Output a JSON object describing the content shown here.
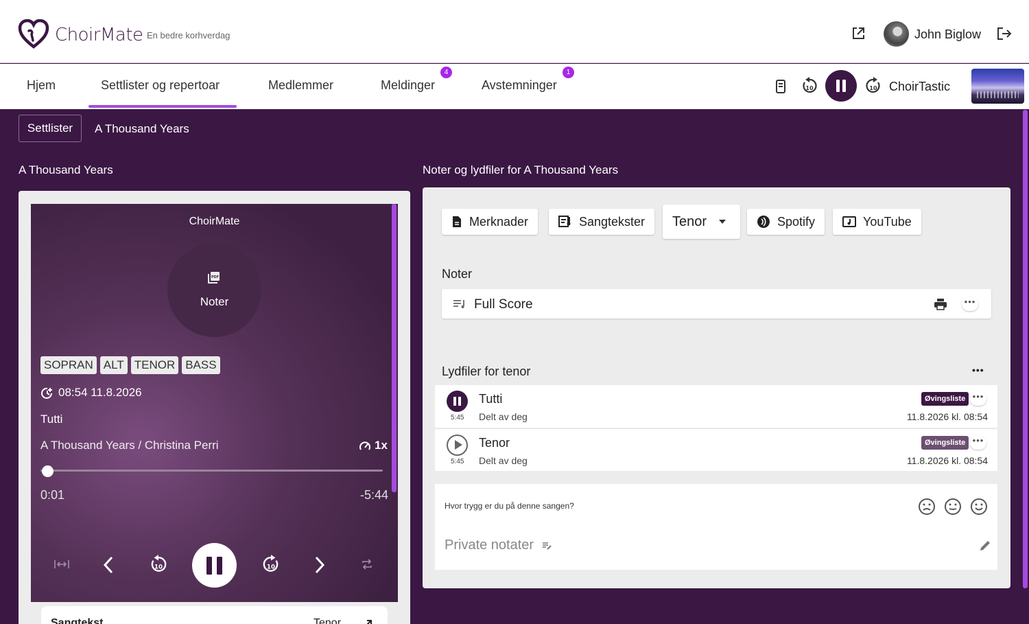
{
  "header": {
    "brand": "ChoirMate",
    "tagline": "En bedre korhverdag",
    "user_name": "John Biglow"
  },
  "nav": {
    "items": [
      {
        "label": "Hjem"
      },
      {
        "label": "Settlister og repertoar",
        "active": true
      },
      {
        "label": "Medlemmer"
      },
      {
        "label": "Meldinger",
        "badge": "4"
      },
      {
        "label": "Avstemninger",
        "badge": "1"
      }
    ],
    "now_playing_choir": "ChoirTastic"
  },
  "breadcrumb": {
    "parent": "Settlister",
    "current": "A Thousand Years"
  },
  "left": {
    "title": "A Thousand Years",
    "player": {
      "brand": "ChoirMate",
      "center_label": "Noter",
      "voices": [
        "SOPRAN",
        "ALT",
        "TENOR",
        "BASS"
      ],
      "timestamp": "08:54 11.8.2026",
      "track": "Tutti",
      "song": "A Thousand Years / Christina Perri",
      "speed": "1x",
      "current_time": "0:01",
      "remaining_time": "-5:44",
      "progress": 0.003
    },
    "bottom_card": {
      "left": "Sangtekst",
      "right": "Tenor"
    }
  },
  "right": {
    "title": "Noter og lydfiler for A Thousand Years",
    "buttons": {
      "notes": "Merknader",
      "lyrics": "Sangtekster",
      "voice_select": "Tenor",
      "spotify": "Spotify",
      "youtube": "YouTube"
    },
    "scores_heading": "Noter",
    "scores": [
      {
        "name": "Full Score"
      }
    ],
    "audio_heading": "Lydfiler for tenor",
    "audio_files": [
      {
        "name": "Tutti",
        "duration": "5:45",
        "shared": "Delt av deg",
        "tag": "Øvingsliste",
        "date": "11.8.2026 kl. 08:54",
        "playing": true
      },
      {
        "name": "Tenor",
        "duration": "5:45",
        "shared": "Delt av deg",
        "tag": "Øvingsliste",
        "date": "11.8.2026 kl. 08:54",
        "playing": false
      }
    ],
    "feedback_question": "Hvor trygg er du på denne sangen?",
    "private_notes_placeholder": "Private notater"
  },
  "colors": {
    "brand_purple": "#3b1744",
    "accent": "#a54be0",
    "badge": "#a728e8"
  }
}
